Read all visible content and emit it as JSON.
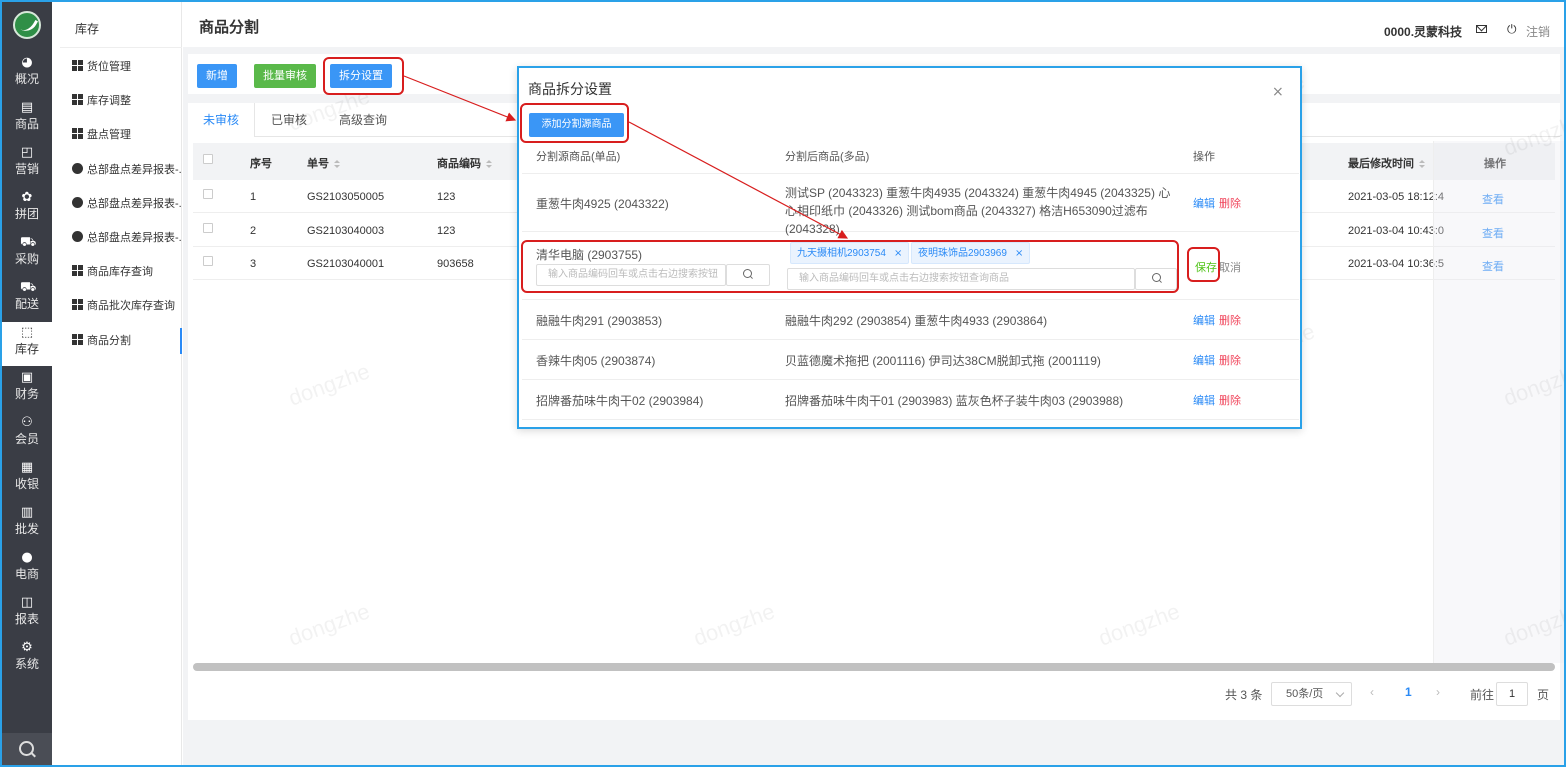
{
  "rail": {
    "items": [
      {
        "icon": "dashboard-icon",
        "glyph": "◕",
        "label": "概况"
      },
      {
        "icon": "document-icon",
        "glyph": "▤",
        "label": "商品"
      },
      {
        "icon": "bag-icon",
        "glyph": "◰",
        "label": "营销"
      },
      {
        "icon": "group-icon",
        "glyph": "✿",
        "label": "拼团"
      },
      {
        "icon": "cart-icon",
        "glyph": "⛟",
        "label": "采购"
      },
      {
        "icon": "truck-icon",
        "glyph": "⛟",
        "label": "配送"
      },
      {
        "icon": "box-icon",
        "glyph": "⬚",
        "label": "库存"
      },
      {
        "icon": "finance-icon",
        "glyph": "▣",
        "label": "财务"
      },
      {
        "icon": "member-icon",
        "glyph": "⚇",
        "label": "会员"
      },
      {
        "icon": "cashier-icon",
        "glyph": "▦",
        "label": "收银"
      },
      {
        "icon": "wholesale-icon",
        "glyph": "▥",
        "label": "批发"
      },
      {
        "icon": "ecommerce-icon",
        "glyph": "●",
        "label": "电商"
      },
      {
        "icon": "report-icon",
        "glyph": "◫",
        "label": "报表"
      },
      {
        "icon": "system-icon",
        "glyph": "⚙",
        "label": "系统"
      }
    ]
  },
  "submenu": {
    "title": "库存",
    "items": [
      {
        "label": "货位管理",
        "icon": "grid-icon"
      },
      {
        "label": "库存调整",
        "icon": "grid-icon"
      },
      {
        "label": "盘点管理",
        "icon": "grid-icon"
      },
      {
        "label": "总部盘点差异报表-...",
        "icon": "circle-icon"
      },
      {
        "label": "总部盘点差异报表-...",
        "icon": "circle-icon"
      },
      {
        "label": "总部盘点差异报表-...",
        "icon": "circle-icon"
      },
      {
        "label": "商品库存查询",
        "icon": "grid-icon"
      },
      {
        "label": "商品批次库存查询",
        "icon": "grid-icon"
      },
      {
        "label": "商品分割",
        "icon": "grid-icon"
      }
    ]
  },
  "header": {
    "title": "商品分割",
    "company": "0000.灵蒙科技",
    "logout": "注销",
    "power_glyph": "⏻"
  },
  "toolbar": {
    "add": "新增",
    "batch_audit": "批量审核",
    "split_settings": "拆分设置"
  },
  "tabs": [
    "未审核",
    "已审核",
    "高级查询"
  ],
  "table": {
    "headers": {
      "seq": "序号",
      "no": "单号",
      "code": "商品编码",
      "modified": "最后修改时间",
      "op": "操作"
    },
    "rows": [
      {
        "seq": "1",
        "no": "GS2103050005",
        "code": "123",
        "modified": "2021-03-05 18:12:4",
        "op": "查看"
      },
      {
        "seq": "2",
        "no": "GS2103040003",
        "code": "123",
        "modified": "2021-03-04 10:43:0",
        "op": "查看"
      },
      {
        "seq": "3",
        "no": "GS2103040001",
        "code": "903658",
        "modified": "2021-03-04 10:36:5",
        "op": "查看"
      }
    ]
  },
  "pager": {
    "total": "共 3 条",
    "page_size": "50条/页",
    "prev": "‹",
    "next": "›",
    "page": "1",
    "goto_label": "前往",
    "goto_value": "1",
    "goto_suffix": "页"
  },
  "watermark": "dongzhe",
  "modal": {
    "title": "商品拆分设置",
    "close_glyph": "×",
    "add_source": "添加分割源商品",
    "headers": {
      "source": "分割源商品(单品)",
      "targets": "分割后商品(多品)",
      "op": "操作"
    },
    "edit_label": "编辑",
    "delete_label": "删除",
    "rows": [
      {
        "source": "重葱牛肉4925 (2043322)",
        "targets": "测试SP (2043323) 重葱牛肉4935 (2043324) 重葱牛肉4945 (2043325) 心心相印纸巾 (2043326) 测试bom商品 (2043327) 格洁H653090过滤布 (2043328)"
      },
      {
        "source": "融融牛肉291 (2903853)",
        "targets": "融融牛肉292 (2903854) 重葱牛肉4933 (2903864)"
      },
      {
        "source": "香辣牛肉05 (2903874)",
        "targets": "贝蓝德魔术拖把 (2001116) 伊司达38CM脱卸式拖 (2001119)"
      },
      {
        "source": "招牌番茄味牛肉干02 (2903984)",
        "targets": "招牌番茄味牛肉干01 (2903983) 蓝灰色杯子装牛肉03 (2903988)"
      }
    ],
    "editing_row": {
      "source": "清华电脑 (2903755)",
      "source_placeholder": "输入商品编码回车或点击右边搜索按钮",
      "tags": [
        "九天摄相机2903754",
        "夜明珠饰品2903969"
      ],
      "tag_close": "×",
      "target_placeholder": "输入商品编码回车或点击右边搜索按钮查询商品",
      "save": "保存",
      "cancel": "取消"
    }
  },
  "colors": {
    "accent": "#2a8af6",
    "success": "#5cb85c",
    "highlight": "#d81e1e",
    "rail": "#3a3d45"
  }
}
